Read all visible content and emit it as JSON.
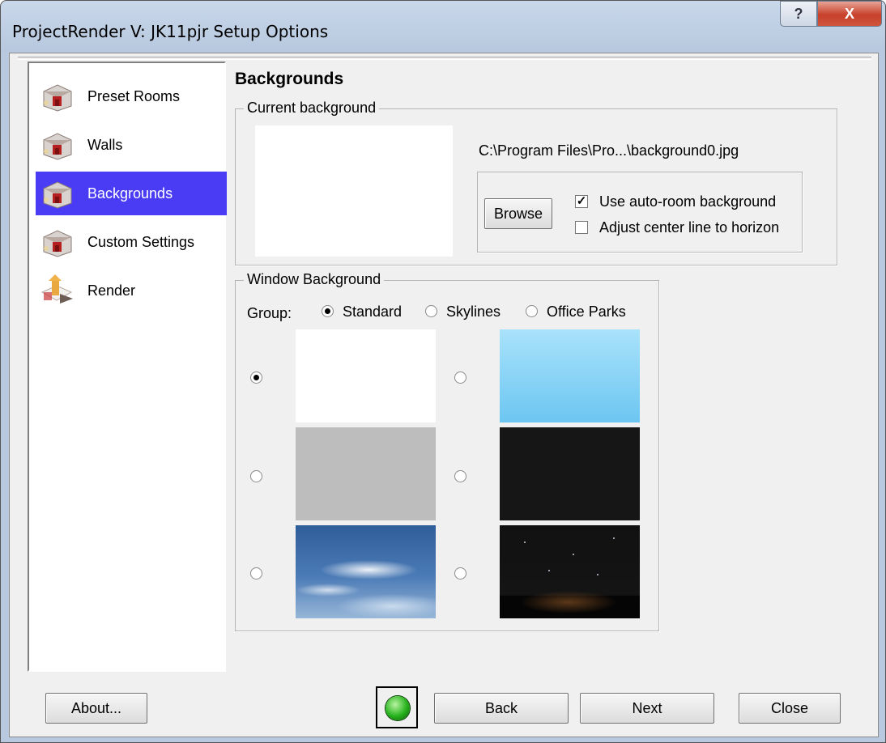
{
  "window": {
    "title": "ProjectRender V:  JK11pjr Setup Options",
    "help_label": "?",
    "close_label": "X"
  },
  "nav": {
    "items": [
      {
        "label": "Preset Rooms",
        "icon": "room-icon"
      },
      {
        "label": "Walls",
        "icon": "room-icon"
      },
      {
        "label": "Backgrounds",
        "icon": "room-icon",
        "selected": true
      },
      {
        "label": "Custom Settings",
        "icon": "room-icon"
      },
      {
        "label": "Render",
        "icon": "render-icon"
      }
    ],
    "selected_color": "#4a3cf5"
  },
  "page": {
    "heading": "Backgrounds"
  },
  "current_background": {
    "legend": "Current background",
    "path": "C:\\Program Files\\Pro...\\background0.jpg",
    "browse_label": "Browse",
    "use_auto_room": {
      "label": "Use auto-room background",
      "checked": true
    },
    "adjust_center": {
      "label": "Adjust center line to horizon",
      "checked": false
    }
  },
  "window_background": {
    "legend": "Window Background",
    "group_label": "Group:",
    "groups": [
      {
        "label": "Standard",
        "checked": true
      },
      {
        "label": "Skylines",
        "checked": false
      },
      {
        "label": "Office Parks",
        "checked": false
      }
    ],
    "options": [
      {
        "name": "white",
        "checked": true
      },
      {
        "name": "light-sky",
        "checked": false
      },
      {
        "name": "gray",
        "checked": false
      },
      {
        "name": "black",
        "checked": false
      },
      {
        "name": "cloudy-sky",
        "checked": false
      },
      {
        "name": "night-sky",
        "checked": false
      }
    ]
  },
  "footer": {
    "about_label": "About...",
    "back_label": "Back",
    "next_label": "Next",
    "close_label": "Close"
  }
}
